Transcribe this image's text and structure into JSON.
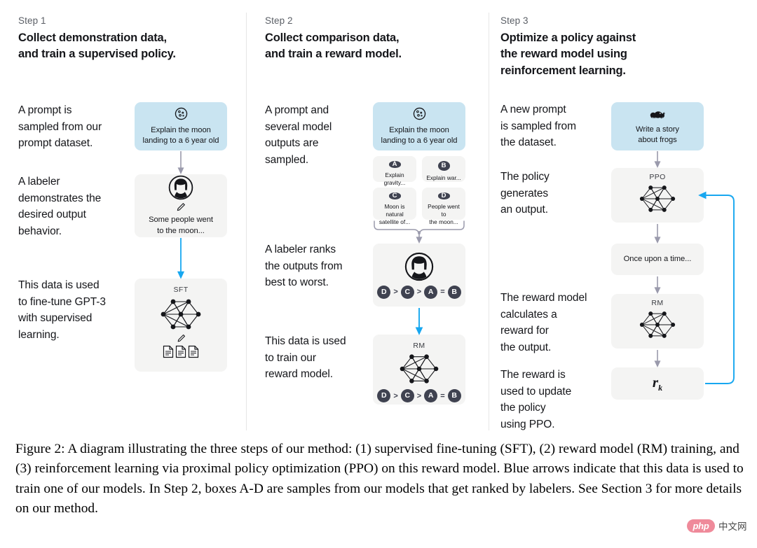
{
  "figure": {
    "caption": "Figure 2: A diagram illustrating the three steps of our method: (1) supervised fine-tuning (SFT), (2) reward model (RM) training, and (3) reinforcement learning via proximal policy optimization (PPO) on this reward model. Blue arrows indicate that this data is used to train one of our models. In Step 2, boxes A-D are samples from our models that get ranked by labelers. See Section 3 for more details on our method."
  },
  "colors": {
    "prompt_box": "#c9e4f1",
    "neutral_box": "#f4f4f3",
    "blue_arrow": "#17a7f0",
    "gray_arrow": "#9a9aac",
    "badge": "#3f4250",
    "divider": "#e6e6e6"
  },
  "steps": [
    {
      "label": "Step 1",
      "title": "Collect demonstration data,\nand train a supervised policy.",
      "descriptions": [
        "A prompt is\nsampled from our\nprompt dataset.",
        "A labeler\ndemonstrates the\ndesired output\nbehavior.",
        "This data is used\nto fine-tune GPT-3\nwith supervised\nlearning."
      ],
      "boxes": [
        {
          "name": "prompt-box",
          "icon": "moon-icon",
          "text": "Explain the moon\nlanding to a 6 year old"
        },
        {
          "name": "labeler-demo-box",
          "icon": "labeler-avatar-icon",
          "text": "Some people went\nto the moon..."
        },
        {
          "name": "sft-model-box",
          "caption": "SFT",
          "icon": "neural-network-icon"
        }
      ]
    },
    {
      "label": "Step 2",
      "title": "Collect comparison data,\nand train a reward model.",
      "descriptions": [
        "A prompt and\nseveral model\noutputs are\nsampled.",
        "A labeler ranks\nthe outputs from\nbest to worst.",
        "This data is used\nto train our\nreward model."
      ],
      "boxes": [
        {
          "name": "prompt-box",
          "icon": "moon-icon",
          "text": "Explain the moon\nlanding to a 6 year old"
        }
      ],
      "samples": [
        {
          "badge": "A",
          "text": "Explain gravity..."
        },
        {
          "badge": "B",
          "text": "Explain war..."
        },
        {
          "badge": "C",
          "text": "Moon is natural\nsatellite of..."
        },
        {
          "badge": "D",
          "text": "People went to\nthe moon..."
        }
      ],
      "ranking": [
        "D",
        ">",
        "C",
        ">",
        "A",
        "=",
        "B"
      ],
      "rm_caption": "RM"
    },
    {
      "label": "Step 3",
      "title": "Optimize a policy against\nthe reward model using\nreinforcement learning.",
      "descriptions": [
        "A new prompt\nis sampled from\nthe dataset.",
        "The policy\ngenerates\nan output.",
        "The reward model\ncalculates a\nreward for\nthe output.",
        "The reward is\nused to update\nthe policy\nusing PPO."
      ],
      "boxes": [
        {
          "name": "prompt-box",
          "icon": "frog-icon",
          "text": "Write a story\nabout frogs"
        },
        {
          "name": "ppo-policy-box",
          "caption": "PPO",
          "icon": "neural-network-icon"
        },
        {
          "name": "output-box",
          "text": "Once upon a time..."
        },
        {
          "name": "reward-model-box",
          "caption": "RM",
          "icon": "neural-network-icon"
        },
        {
          "name": "reward-value-box",
          "value": "r",
          "subscript": "k"
        }
      ]
    }
  ],
  "watermark": {
    "logo_text": "php",
    "site_text": "中文网"
  }
}
